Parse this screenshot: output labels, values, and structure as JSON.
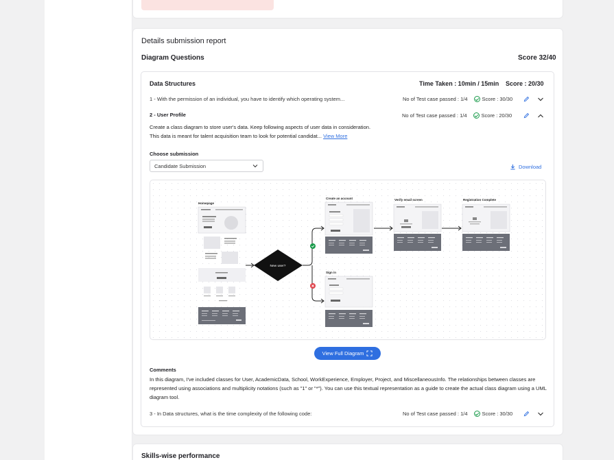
{
  "report": {
    "title": "Details submission report",
    "section_title": "Diagram Questions",
    "section_score": "Score 32/40"
  },
  "data_structures": {
    "title": "Data Structures",
    "time_taken": "Time Taken : 10min / 15min",
    "score": "Score : 20/30"
  },
  "questions": [
    {
      "title": "1 - With the permission of an individual, you have to identify which operating system...",
      "test_cases": "No of Test case passed : 1/4",
      "score": "Score : 30/30"
    },
    {
      "title": "2 - User Profile",
      "test_cases": "No of Test case passed : 1/4",
      "score": "Score : 20/30",
      "description": "Create a class diagram to store user's data. Keep following aspects of user data in consideration. This data is meant for talent acquisition team to look for potential candidat...",
      "view_more": "View More"
    },
    {
      "title": "3 - In Data structures, what is the time complexity of the following code:",
      "test_cases": "No of Test case passed : 1/4",
      "score": "Score : 30/30"
    }
  ],
  "submission": {
    "choose_label": "Choose submission",
    "selected": "Candidate Submission",
    "download_label": "Download"
  },
  "diagram": {
    "homepage": "Homepage",
    "decision": "New user?",
    "create_account": "Create an account",
    "verify_email": "Verify email screen",
    "registration_complete": "Registration Complete",
    "sign_in": "Sign in",
    "view_full_label": "View Full Diagram"
  },
  "comments": {
    "label": "Comments",
    "text": "In this diagram, I've included classes for User, AcademicData, School, WorkExperience, Employer, Project, and MiscellaneousInfo. The relationships between classes are represented using associations and multiplicity notations (such as \"1\" or \"*\"). You can use this textual representation as a guide to create the actual class diagram using a UML diagram tool."
  },
  "skills": {
    "title": "Skills-wise performance"
  },
  "colors": {
    "accent": "#2f6fe0",
    "success": "#1a9b4b",
    "error": "#e0434b",
    "alert_bg": "#fbe3e1"
  }
}
